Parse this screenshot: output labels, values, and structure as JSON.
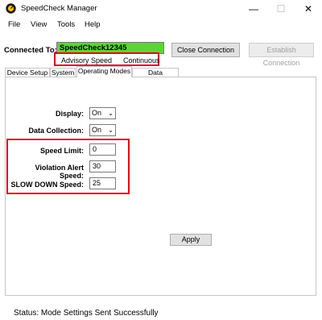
{
  "window": {
    "title": "SpeedCheck Manager",
    "icon": "speedcheck-app-icon",
    "controls": {
      "minimize": "—",
      "maximize": "☐",
      "close": "✕"
    }
  },
  "menu": {
    "items": [
      "File",
      "View",
      "Tools",
      "Help"
    ]
  },
  "connection": {
    "label": "Connected To:",
    "device_name": "SpeedCheck12345",
    "close_label": "Close Connection",
    "establish_label": "Establish Connection",
    "mode_advisory": "Advisory Speed",
    "mode_continuous": "Continuous",
    "device_field_color": "#5ad633",
    "highlight_color": "#e3001b"
  },
  "tabs": [
    {
      "label": "Device Setup"
    },
    {
      "label": "System"
    },
    {
      "label": "Operating Modes",
      "active": true
    },
    {
      "label": "Data Collection"
    }
  ],
  "form": {
    "display_label": "Display:",
    "display_value": "On",
    "data_collection_label": "Data Collection:",
    "data_collection_value": "On",
    "speed_limit_label": "Speed Limit:",
    "speed_limit_value": "0",
    "violation_label": "Violation Alert Speed:",
    "violation_value": "30",
    "slow_down_label": "SLOW DOWN Speed:",
    "slow_down_value": "25",
    "apply_label": "Apply"
  },
  "status": {
    "text": "Status:  Mode Settings Sent Successfully"
  }
}
